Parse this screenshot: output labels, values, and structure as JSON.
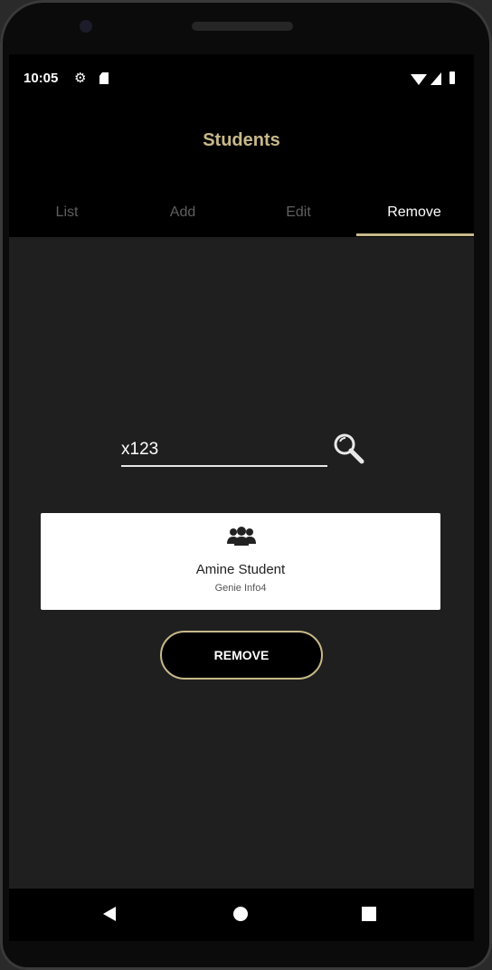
{
  "status_bar": {
    "time": "10:05",
    "icons": [
      "gear-icon",
      "sim-icon",
      "wifi-icon",
      "signal-icon",
      "battery-icon"
    ]
  },
  "app_bar": {
    "title": "Students"
  },
  "tabs": [
    {
      "label": "List",
      "active": false
    },
    {
      "label": "Add",
      "active": false
    },
    {
      "label": "Edit",
      "active": false
    },
    {
      "label": "Remove",
      "active": true
    }
  ],
  "search": {
    "value": "x123",
    "icon": "search-icon"
  },
  "result_card": {
    "icon": "group-icon",
    "name": "Amine Student",
    "subtitle": "Genie Info4"
  },
  "remove_button": {
    "label": "REMOVE"
  },
  "navigation_bar": {
    "buttons": [
      "back-icon",
      "home-icon",
      "recents-icon"
    ]
  },
  "colors": {
    "accent": "#c8b98a",
    "background": "#000000",
    "content_background": "#1f1f1f",
    "card_background": "#ffffff"
  }
}
